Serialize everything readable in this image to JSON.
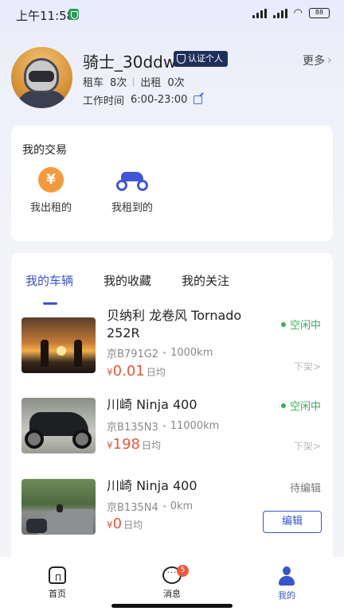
{
  "status_bar": {
    "time": "上午11:58",
    "battery": "88"
  },
  "profile": {
    "username": "骑士_30ddw",
    "badge": "认证个人",
    "more": "更多",
    "rent_label": "租车",
    "rent_count": "8次",
    "lend_label": "出租",
    "lend_count": "0次",
    "worktime_label": "工作时间",
    "worktime_value": "6:00-23:00"
  },
  "trade": {
    "title": "我的交易",
    "items": [
      {
        "label": "我出租的",
        "icon": "yen-icon"
      },
      {
        "label": "我租到的",
        "icon": "motorcycle-icon"
      }
    ]
  },
  "tabs": [
    {
      "label": "我的车辆",
      "active": true
    },
    {
      "label": "我的收藏",
      "active": false
    },
    {
      "label": "我的关注",
      "active": false
    }
  ],
  "vehicles": [
    {
      "title": "贝纳利 龙卷风 Tornado 252R",
      "plate": "京B791G2",
      "mileage": "1000km",
      "currency": "¥",
      "price": "0.01",
      "unit": "日均",
      "status": "空闲中",
      "action": "下架>"
    },
    {
      "title": "川崎 Ninja 400",
      "plate": "京B135N3",
      "mileage": "11000km",
      "currency": "¥",
      "price": "198",
      "unit": "日均",
      "status": "空闲中",
      "action": "下架>"
    },
    {
      "title": "川崎 Ninja 400",
      "plate": "京B135N4",
      "mileage": "0km",
      "currency": "¥",
      "price": "0",
      "unit": "日均",
      "status": "待编辑",
      "action": "编辑"
    }
  ],
  "nav": [
    {
      "label": "首页",
      "icon": "home-icon"
    },
    {
      "label": "消息",
      "icon": "message-icon",
      "badge": "5"
    },
    {
      "label": "我的",
      "icon": "profile-icon",
      "active": true
    }
  ],
  "colors": {
    "accent": "#3a55c9",
    "price": "#e05a3a",
    "idle": "#3dae5a",
    "badge_bg": "#1f2f5c"
  }
}
